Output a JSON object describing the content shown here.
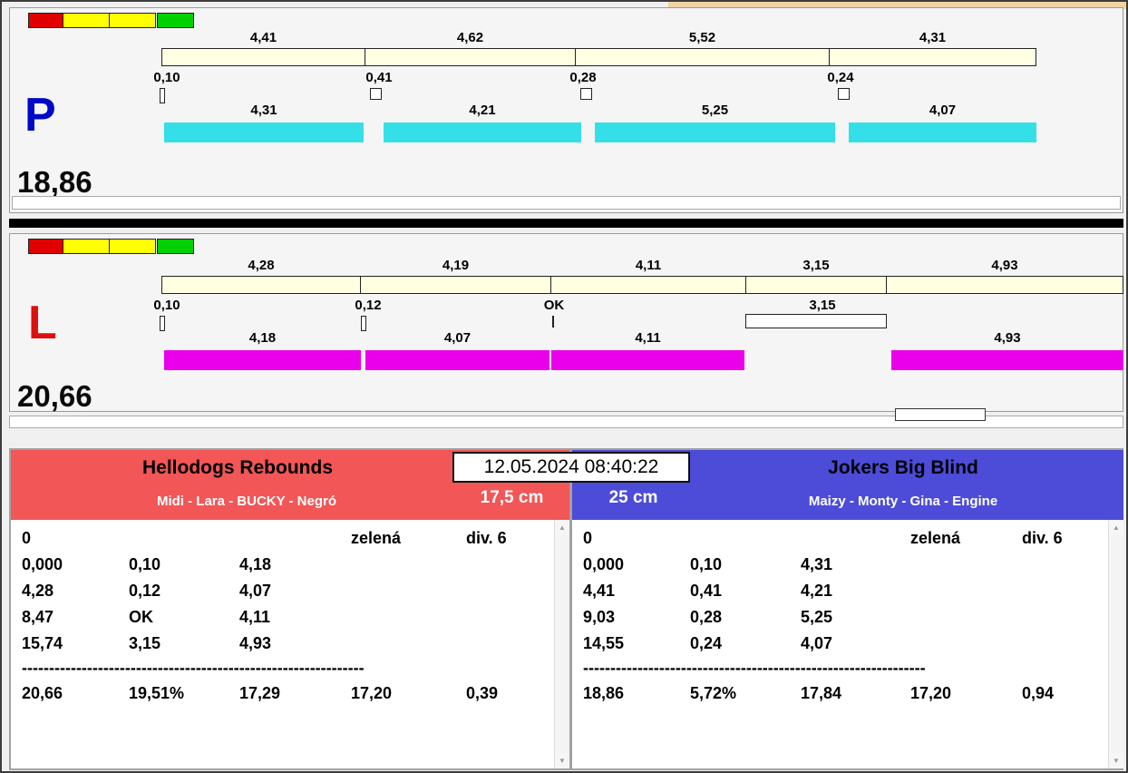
{
  "datetime": "12.05.2024 08:40:22",
  "panel_p": {
    "label": "P",
    "total": "18,86",
    "top_segments": [
      "4,41",
      "4,62",
      "5,52",
      "4,31"
    ],
    "markers": [
      "0,10",
      "0,41",
      "0,28",
      "0,24"
    ],
    "bars": [
      "4,31",
      "4,21",
      "5,25",
      "4,07"
    ]
  },
  "panel_l": {
    "label": "L",
    "total": "20,66",
    "top_segments": [
      "4,28",
      "4,19",
      "4,11",
      "3,15",
      "4,93"
    ],
    "markers": [
      "0,10",
      "0,12",
      "OK",
      "3,15"
    ],
    "bars": [
      "4,18",
      "4,07",
      "4,11",
      "4,93"
    ]
  },
  "teams": {
    "left": {
      "name": "Hellodogs Rebounds",
      "members": "Midi - Lara - BUCKY - Negró",
      "height": "17,5 cm",
      "status": "0",
      "flag": "zelená",
      "division": "div. 6",
      "rows": [
        [
          "0,000",
          "0,10",
          "4,18"
        ],
        [
          "4,28",
          "0,12",
          "4,07"
        ],
        [
          "8,47",
          "OK",
          "4,11"
        ],
        [
          "15,74",
          "3,15",
          "4,93"
        ]
      ],
      "separator": "---------------------------------------------------------------",
      "totals": [
        "20,66",
        "19,51%",
        "17,29",
        "17,20",
        "0,39"
      ]
    },
    "right": {
      "name": "Jokers Big Blind",
      "members": "Maizy - Monty - Gina - Engine",
      "height": "25 cm",
      "status": "0",
      "flag": "zelená",
      "division": "div. 6",
      "rows": [
        [
          "0,000",
          "0,10",
          "4,31"
        ],
        [
          "4,41",
          "0,41",
          "4,21"
        ],
        [
          "9,03",
          "0,28",
          "5,25"
        ],
        [
          "14,55",
          "0,24",
          "4,07"
        ]
      ],
      "separator": "---------------------------------------------------------------",
      "totals": [
        "18,86",
        "5,72%",
        "17,84",
        "17,20",
        "0,94"
      ]
    }
  },
  "icons": {
    "scroll_up": "▲",
    "scroll_down": "▼"
  },
  "colors": {
    "p_bar": "#35dfe8",
    "l_bar": "#ea00ea",
    "left_header": "#f25656",
    "right_header": "#4c4cd8",
    "light_red": "#e00000",
    "light_yellow": "#ffff00",
    "light_green": "#00d000",
    "cream": "#ffffe2"
  }
}
